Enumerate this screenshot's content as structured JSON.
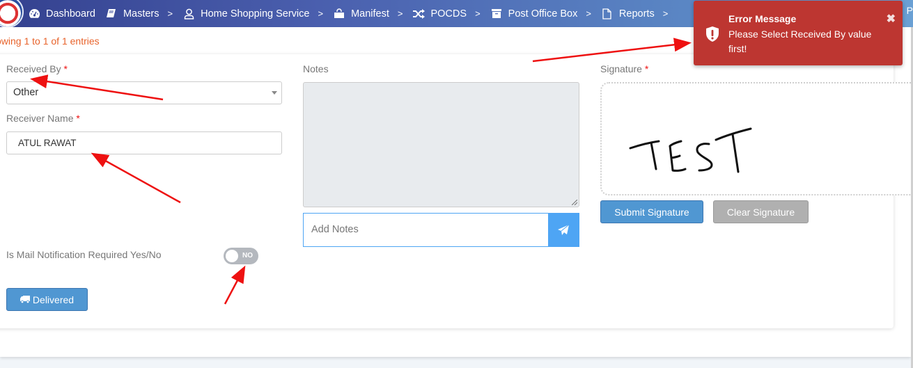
{
  "nav": {
    "items": [
      {
        "label": "Dashboard",
        "icon": "dashboard-gauge-icon",
        "has_chevron": false
      },
      {
        "label": "Masters",
        "icon": "book-icon",
        "has_chevron": true
      },
      {
        "label": "Home Shopping Service",
        "icon": "user-icon",
        "has_chevron": true
      },
      {
        "label": "Manifest",
        "icon": "shopping-bag-icon",
        "has_chevron": true
      },
      {
        "label": "POCDS",
        "icon": "random-shuffle-icon",
        "has_chevron": true
      },
      {
        "label": "Post Office Box",
        "icon": "archive-box-icon",
        "has_chevron": true
      },
      {
        "label": "Reports",
        "icon": "file-icon",
        "has_chevron": true
      }
    ],
    "trailing_text": "P",
    "chevron": ">"
  },
  "entries_info": "owing 1 to 1 of 1 entries",
  "form": {
    "received_by": {
      "label": "Received By",
      "required_mark": "*",
      "value": "Other"
    },
    "receiver_name": {
      "label": "Receiver Name",
      "required_mark": "*",
      "value": "ATUL RAWAT"
    },
    "mail_notification": {
      "label": "Is Mail Notification Required Yes/No",
      "toggle_text": "NO",
      "enabled": false
    },
    "delivered_button": "Delivered",
    "notes": {
      "label": "Notes",
      "value": "",
      "add_placeholder": "Add Notes"
    },
    "signature": {
      "label": "Signature",
      "required_mark": "*",
      "drawn_text": "TEST",
      "submit_label": "Submit Signature",
      "clear_label": "Clear Signature"
    }
  },
  "toast": {
    "title": "Error Message",
    "message": "Please Select Received By value first!",
    "close": "✖",
    "color": "#bd3631"
  },
  "colors": {
    "primary_button": "#5097d2",
    "accent_blue": "#4ea5f4",
    "entries_text": "#e8632b",
    "annotation_arrow": "#ee1111"
  }
}
